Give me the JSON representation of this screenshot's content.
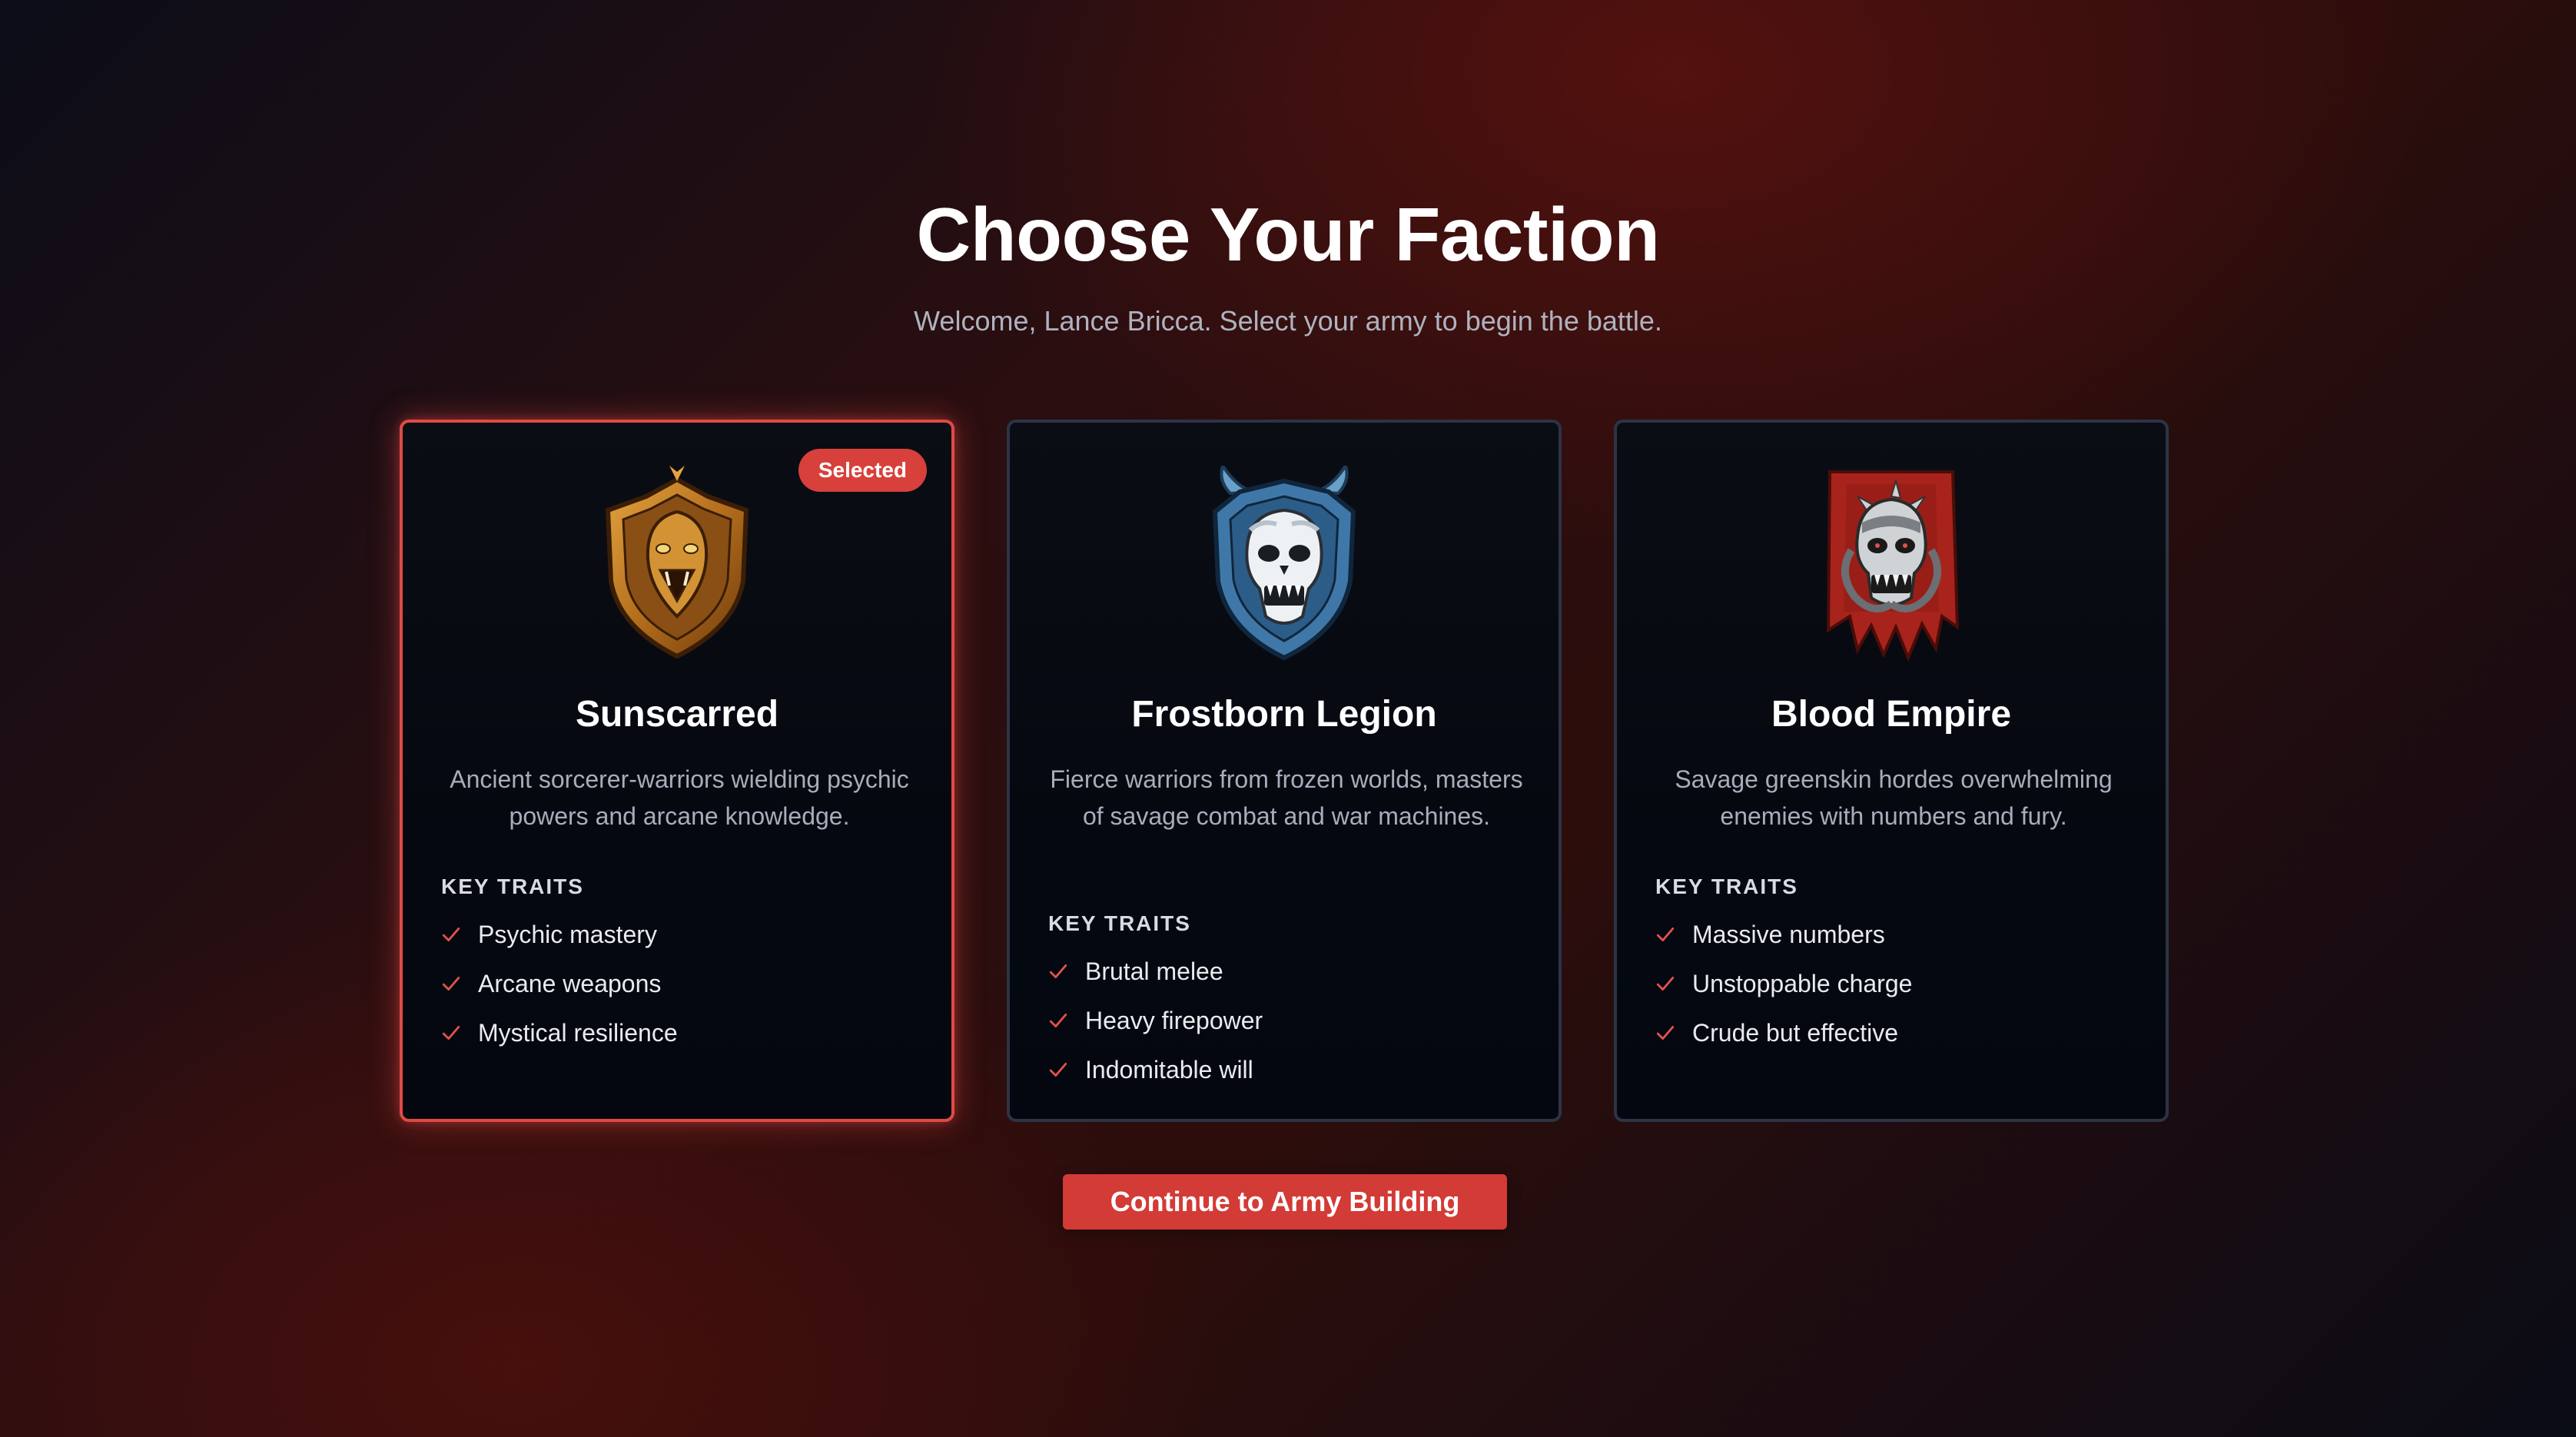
{
  "header": {
    "title": "Choose Your Faction",
    "subtitle": "Welcome, Lance Bricca. Select your army to begin the battle."
  },
  "factions": [
    {
      "name": "Sunscarred",
      "description": "Ancient sorcerer-warriors wielding psychic powers and arcane knowledge.",
      "traits_heading": "KEY TRAITS",
      "traits": [
        "Psychic mastery",
        "Arcane weapons",
        "Mystical resilience"
      ],
      "selected": true,
      "badge": "Selected",
      "emblem": "cobra-shield-icon",
      "color": "#c9862a"
    },
    {
      "name": "Frostborn Legion",
      "description": "Fierce warriors from frozen worlds, masters of savage combat and war machines.",
      "traits_heading": "KEY TRAITS",
      "traits": [
        "Brutal melee",
        "Heavy firepower",
        "Indomitable will"
      ],
      "selected": false,
      "emblem": "yeti-skull-shield-icon",
      "color": "#3f78a8"
    },
    {
      "name": "Blood Empire",
      "description": "Savage greenskin hordes overwhelming enemies with numbers and fury.",
      "traits_heading": "KEY TRAITS",
      "traits": [
        "Massive numbers",
        "Unstoppable charge",
        "Crude but effective"
      ],
      "selected": false,
      "emblem": "skull-banner-icon",
      "color": "#a8231c"
    }
  ],
  "actions": {
    "continue_label": "Continue to Army Building"
  },
  "theme": {
    "accent": "#d8403b",
    "card_border": "#2c3445"
  }
}
